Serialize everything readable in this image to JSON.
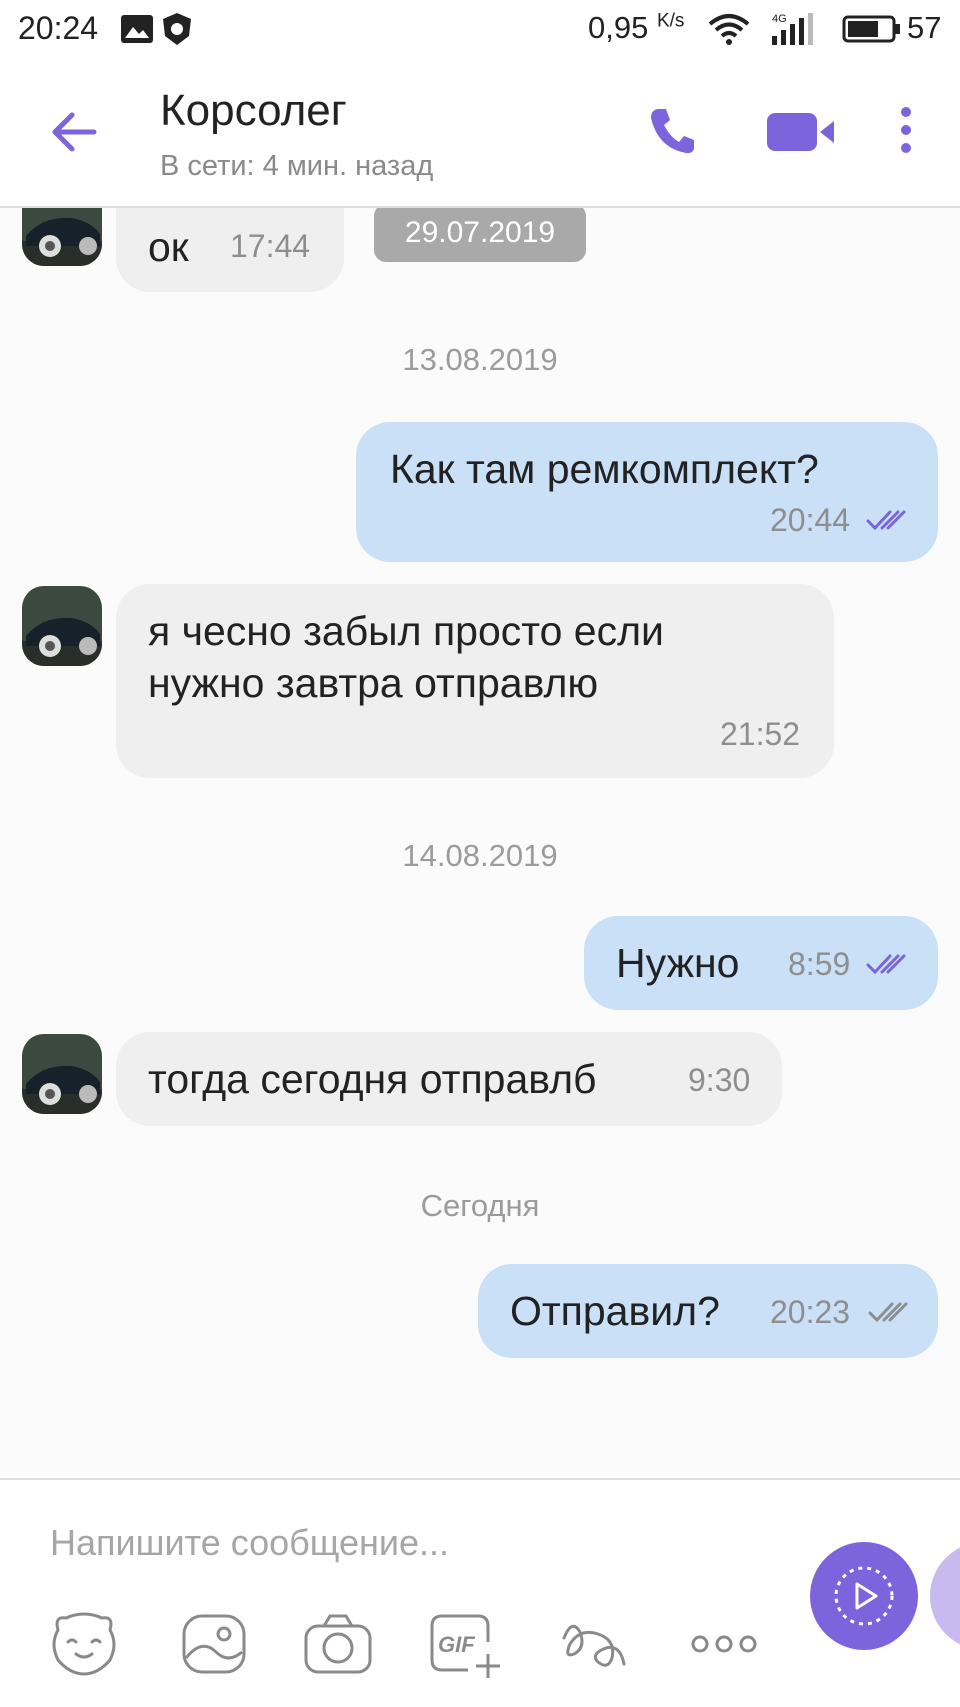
{
  "status_bar": {
    "time": "20:24",
    "speed": "0,95",
    "speed_unit": "K/s",
    "network": "4G",
    "battery": "57"
  },
  "header": {
    "contact_name": "Корсолег",
    "status": "В сети: 4 мин. назад",
    "icons": [
      "back-arrow-icon",
      "phone-icon",
      "video-call-icon",
      "more-vert-icon"
    ]
  },
  "chat": {
    "floating_date": "29.07.2019",
    "messages": [
      {
        "dir": "in",
        "text": "ок",
        "time": "17:44"
      },
      {
        "type": "date",
        "text": "13.08.2019"
      },
      {
        "dir": "out",
        "text": "Как там ремкомплект?",
        "time": "20:44",
        "status": "read"
      },
      {
        "dir": "in",
        "text_line1": "я чесно забыл просто если",
        "text_line2": "нужно завтра отправлю",
        "time": "21:52"
      },
      {
        "type": "date",
        "text": "14.08.2019"
      },
      {
        "dir": "out",
        "text": "Нужно",
        "time": "8:59",
        "status": "read"
      },
      {
        "dir": "in",
        "text": "тогда сегодня отправлб",
        "time": "9:30"
      },
      {
        "type": "date",
        "text": "Сегодня"
      },
      {
        "dir": "out",
        "text": "Отправил?",
        "time": "20:23",
        "status": "delivered"
      }
    ]
  },
  "composer": {
    "placeholder": "Напишите сообщение...",
    "tools": [
      "sticker-icon",
      "gallery-icon",
      "camera-icon",
      "gif-icon",
      "doodle-icon",
      "more-horiz-icon"
    ],
    "send_icon": "video-message-icon"
  },
  "colors": {
    "accent": "#7c64dc",
    "outgoing_bubble": "#c9e0f7",
    "incoming_bubble": "#efefef",
    "read_ticks": "#7c64dc",
    "delivered_ticks": "#8e8e8e"
  }
}
